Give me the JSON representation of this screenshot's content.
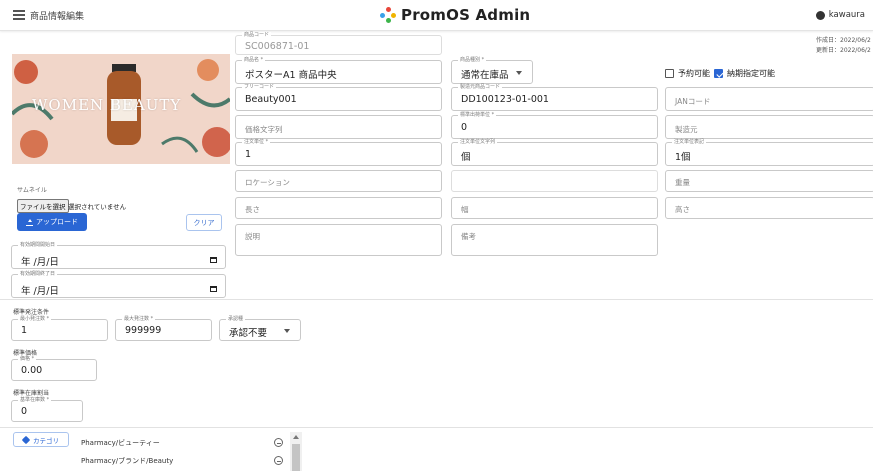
{
  "header": {
    "page_title": "商品情報編集",
    "brand": "PromOS Admin",
    "user": "kawaura"
  },
  "meta": {
    "created": "作成日：2022/06/2",
    "updated": "更新日：2022/06/2"
  },
  "thumbnail": {
    "label": "サムネイル",
    "file_button": "ファイルを選択",
    "file_status": "選択されていません",
    "upload_label": "アップロード",
    "clear_label": "クリア",
    "image_text": "WOMEN BEAUTY"
  },
  "fields": {
    "product_code": {
      "label": "商品コード",
      "value": "SC006871-01"
    },
    "product_name": {
      "label": "商品名 *",
      "value": "ポスターA1 商品中央"
    },
    "product_type": {
      "label": "商品種別 *",
      "value": "通常在庫品"
    },
    "free_code": {
      "label": "フリーコード",
      "value": "Beauty001"
    },
    "maker_code": {
      "label": "製造元商品コード",
      "value": "DD100123-01-001"
    },
    "jan": {
      "placeholder": "JANコード"
    },
    "price_text": {
      "placeholder": "価格文字列"
    },
    "lot_qty": {
      "label": "標準出荷単位 *",
      "value": "0"
    },
    "maker": {
      "placeholder": "製造元"
    },
    "order_unit": {
      "label": "注文単位 *",
      "value": "1"
    },
    "order_unit_text": {
      "label": "注文単位文字列",
      "value": "個"
    },
    "order_unit_display": {
      "label": "注文単位表記",
      "value": "1個"
    },
    "location": {
      "placeholder": "ロケーション"
    },
    "weight": {
      "placeholder": "重量"
    },
    "length": {
      "placeholder": "長さ"
    },
    "width": {
      "placeholder": "幅"
    },
    "height": {
      "placeholder": "高さ"
    },
    "description": {
      "placeholder": "説明"
    },
    "note": {
      "placeholder": "備考"
    },
    "valid_from": {
      "label": "有効期間開始日",
      "value": "年 /月/日"
    },
    "valid_to": {
      "label": "有効期間終了日",
      "value": "年 /月/日"
    }
  },
  "checkboxes": {
    "reservable": {
      "label": "予約可能",
      "checked": false
    },
    "delivery_date": {
      "label": "納期指定可能",
      "checked": true
    }
  },
  "order_conditions": {
    "title": "標準発注条件",
    "min_qty": {
      "label": "最小発注数 *",
      "value": "1"
    },
    "max_qty": {
      "label": "最大発注数 *",
      "value": "999999"
    },
    "approval": {
      "label": "承認種",
      "value": "承認不要"
    }
  },
  "standard_price": {
    "title": "標準価格",
    "price": {
      "label": "価格 *",
      "value": "0.00"
    }
  },
  "stock_alloc": {
    "title": "標準在庫割当",
    "qty": {
      "label": "基準在庫数 *",
      "value": "0"
    }
  },
  "categories": {
    "button_label": "カテゴリ",
    "items": [
      "Pharmacy/ビューティー",
      "Pharmacy/ブランド/Beauty"
    ]
  },
  "colors": {
    "accent": "#2a66d4"
  }
}
